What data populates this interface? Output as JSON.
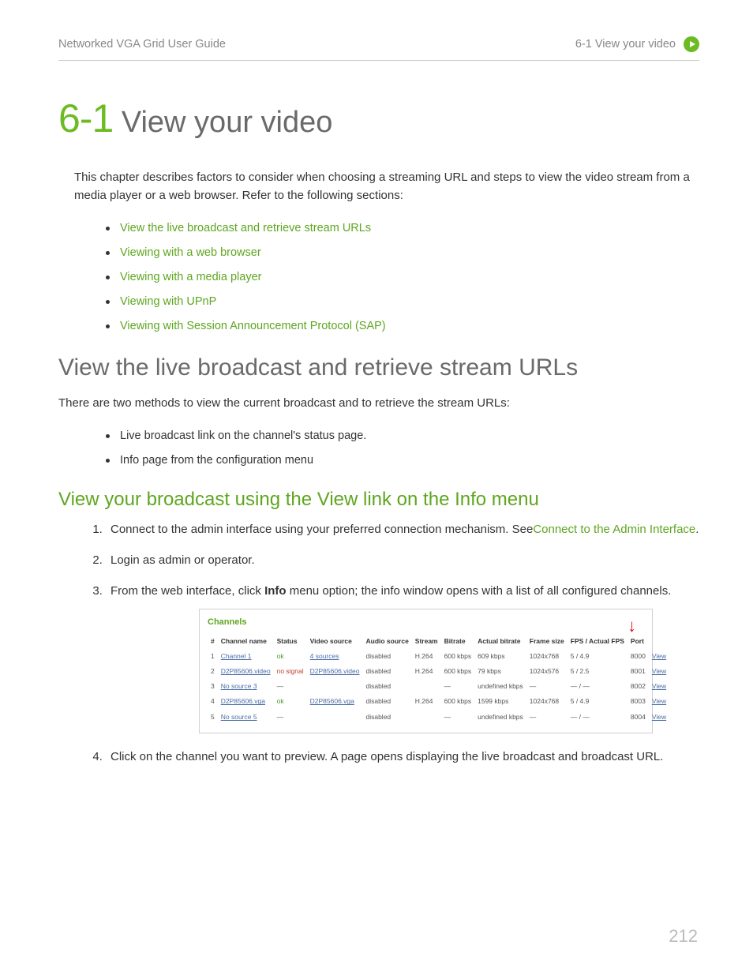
{
  "header": {
    "left": "Networked VGA Grid User Guide",
    "right": "6-1  View your video"
  },
  "title": {
    "num": "6-1",
    "text": " View your video"
  },
  "intro": "This chapter describes factors to consider when choosing a streaming URL and steps to view the video stream from a media player or a web browser. Refer to the following sections:",
  "toc": [
    "View the live broadcast and retrieve stream URLs",
    "Viewing with a web browser",
    "Viewing with a media player",
    "Viewing with UPnP",
    "Viewing with Session Announcement Protocol (SAP)"
  ],
  "section1": {
    "heading": "View the live broadcast and retrieve stream URLs",
    "intro": "There are two methods to view the current broadcast and to retrieve the stream URLs:",
    "bullets": [
      "Live broadcast link on the channel's status page.",
      "Info page from the configuration menu"
    ]
  },
  "sub1": {
    "heading": "View your broadcast using the View link on the Info menu",
    "step1_pre": "Connect to the admin interface using your preferred connection mechanism. See",
    "step1_link": "Connect to the Admin Interface",
    "step1_post": ".",
    "step2": "Login as admin or operator.",
    "step3_pre": "From the web interface, click ",
    "step3_bold": "Info",
    "step3_post": " menu option; the info window opens with a list of all configured channels.",
    "step4": "Click on the channel you want to preview. A page opens displaying the live broadcast and broadcast URL."
  },
  "screenshot": {
    "title": "Channels",
    "headers": [
      "#",
      "Channel name",
      "Status",
      "Video source",
      "Audio source",
      "Stream",
      "Bitrate",
      "Actual bitrate",
      "Frame size",
      "FPS / Actual FPS",
      "Port",
      ""
    ],
    "rows": [
      {
        "n": "1",
        "name": "Channel 1",
        "status": "ok",
        "statusClass": "ok",
        "vs": "4 sources",
        "vslink": true,
        "as": "disabled",
        "stream": "H.264",
        "br": "600 kbps",
        "abr": "609 kbps",
        "fs": "1024x768",
        "fps": "5 / 4.9",
        "port": "8000",
        "view": "View"
      },
      {
        "n": "2",
        "name": "D2P85606.video",
        "status": "no signal",
        "statusClass": "nosig",
        "vs": "D2P85606.video",
        "vslink": true,
        "as": "disabled",
        "stream": "H.264",
        "br": "600 kbps",
        "abr": "79 kbps",
        "fs": "1024x576",
        "fps": "5 / 2.5",
        "port": "8001",
        "view": "View"
      },
      {
        "n": "3",
        "name": "No source 3",
        "status": "—",
        "statusClass": "",
        "vs": "",
        "vslink": false,
        "as": "disabled",
        "stream": "",
        "br": "—",
        "abr": "undefined kbps",
        "fs": "—",
        "fps": "— / —",
        "port": "8002",
        "view": "View"
      },
      {
        "n": "4",
        "name": "D2P85606.vga",
        "status": "ok",
        "statusClass": "ok",
        "vs": "D2P85606.vga",
        "vslink": true,
        "as": "disabled",
        "stream": "H.264",
        "br": "600 kbps",
        "abr": "1599 kbps",
        "fs": "1024x768",
        "fps": "5 / 4.9",
        "port": "8003",
        "view": "View"
      },
      {
        "n": "5",
        "name": "No source 5",
        "status": "—",
        "statusClass": "",
        "vs": "",
        "vslink": false,
        "as": "disabled",
        "stream": "",
        "br": "—",
        "abr": "undefined kbps",
        "fs": "—",
        "fps": "— / —",
        "port": "8004",
        "view": "View"
      }
    ]
  },
  "pageNumber": "212"
}
